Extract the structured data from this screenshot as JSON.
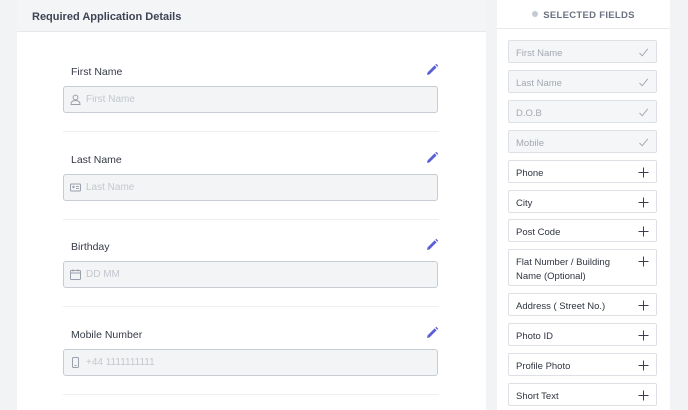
{
  "form": {
    "title": "Required Application Details",
    "fields": [
      {
        "label": "First Name",
        "placeholder": "First Name",
        "icon": "user-icon"
      },
      {
        "label": "Last Name",
        "placeholder": "Last Name",
        "icon": "id-card-icon"
      },
      {
        "label": "Birthday",
        "placeholder": "DD MM",
        "icon": "calendar-icon"
      },
      {
        "label": "Mobile Number",
        "placeholder": "+44 1111111111",
        "icon": "mobile-icon"
      }
    ],
    "edit_icon": "pencil-icon",
    "accent_color": "#5b5fd6"
  },
  "sidebar": {
    "title": "SELECTED FIELDS",
    "selected": [
      {
        "label": "First Name"
      },
      {
        "label": "Last Name"
      },
      {
        "label": "D.O.B"
      },
      {
        "label": "Mobile"
      }
    ],
    "available": [
      {
        "label": "Phone"
      },
      {
        "label": "City"
      },
      {
        "label": "Post Code"
      },
      {
        "label": "Flat Number / Building Name (Optional)"
      },
      {
        "label": "Address ( Street No.)"
      },
      {
        "label": "Photo ID"
      },
      {
        "label": "Profile Photo"
      },
      {
        "label": "Short Text"
      }
    ],
    "selected_icon": "check-icon",
    "available_icon": "plus-icon"
  }
}
